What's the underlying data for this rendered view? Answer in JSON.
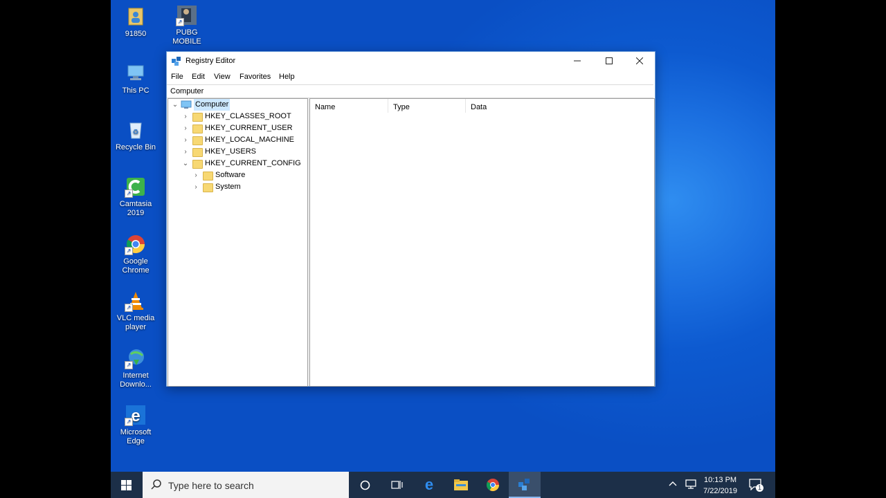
{
  "desktop": {
    "icons": [
      {
        "label": "91850",
        "icon": "user-folder-icon"
      },
      {
        "label": "PUBG\nMOBILE",
        "icon": "pubg-icon"
      },
      {
        "label": "This PC",
        "icon": "computer-icon"
      },
      {
        "label": "Recycle Bin",
        "icon": "recycle-bin-icon"
      },
      {
        "label": "Camtasia\n2019",
        "icon": "camtasia-icon"
      },
      {
        "label": "Google\nChrome",
        "icon": "chrome-icon"
      },
      {
        "label": "VLC media\nplayer",
        "icon": "vlc-icon"
      },
      {
        "label": "Internet\nDownlo...",
        "icon": "idm-icon"
      },
      {
        "label": "Microsoft\nEdge",
        "icon": "edge-icon"
      }
    ]
  },
  "window": {
    "title": "Registry Editor",
    "menu": [
      "File",
      "Edit",
      "View",
      "Favorites",
      "Help"
    ],
    "address": "Computer",
    "tree": {
      "root": "Computer",
      "hives": [
        "HKEY_CLASSES_ROOT",
        "HKEY_CURRENT_USER",
        "HKEY_LOCAL_MACHINE",
        "HKEY_USERS",
        "HKEY_CURRENT_CONFIG"
      ],
      "expanded_children": [
        "Software",
        "System"
      ]
    },
    "columns": [
      "Name",
      "Type",
      "Data"
    ]
  },
  "taskbar": {
    "search_placeholder": "Type here to search",
    "time": "10:13 PM",
    "date": "7/22/2019",
    "notification_count": "1"
  },
  "colors": {
    "desktop": "#0a56cc",
    "taskbar": "#1c2f48",
    "selection": "#cce8ff"
  }
}
